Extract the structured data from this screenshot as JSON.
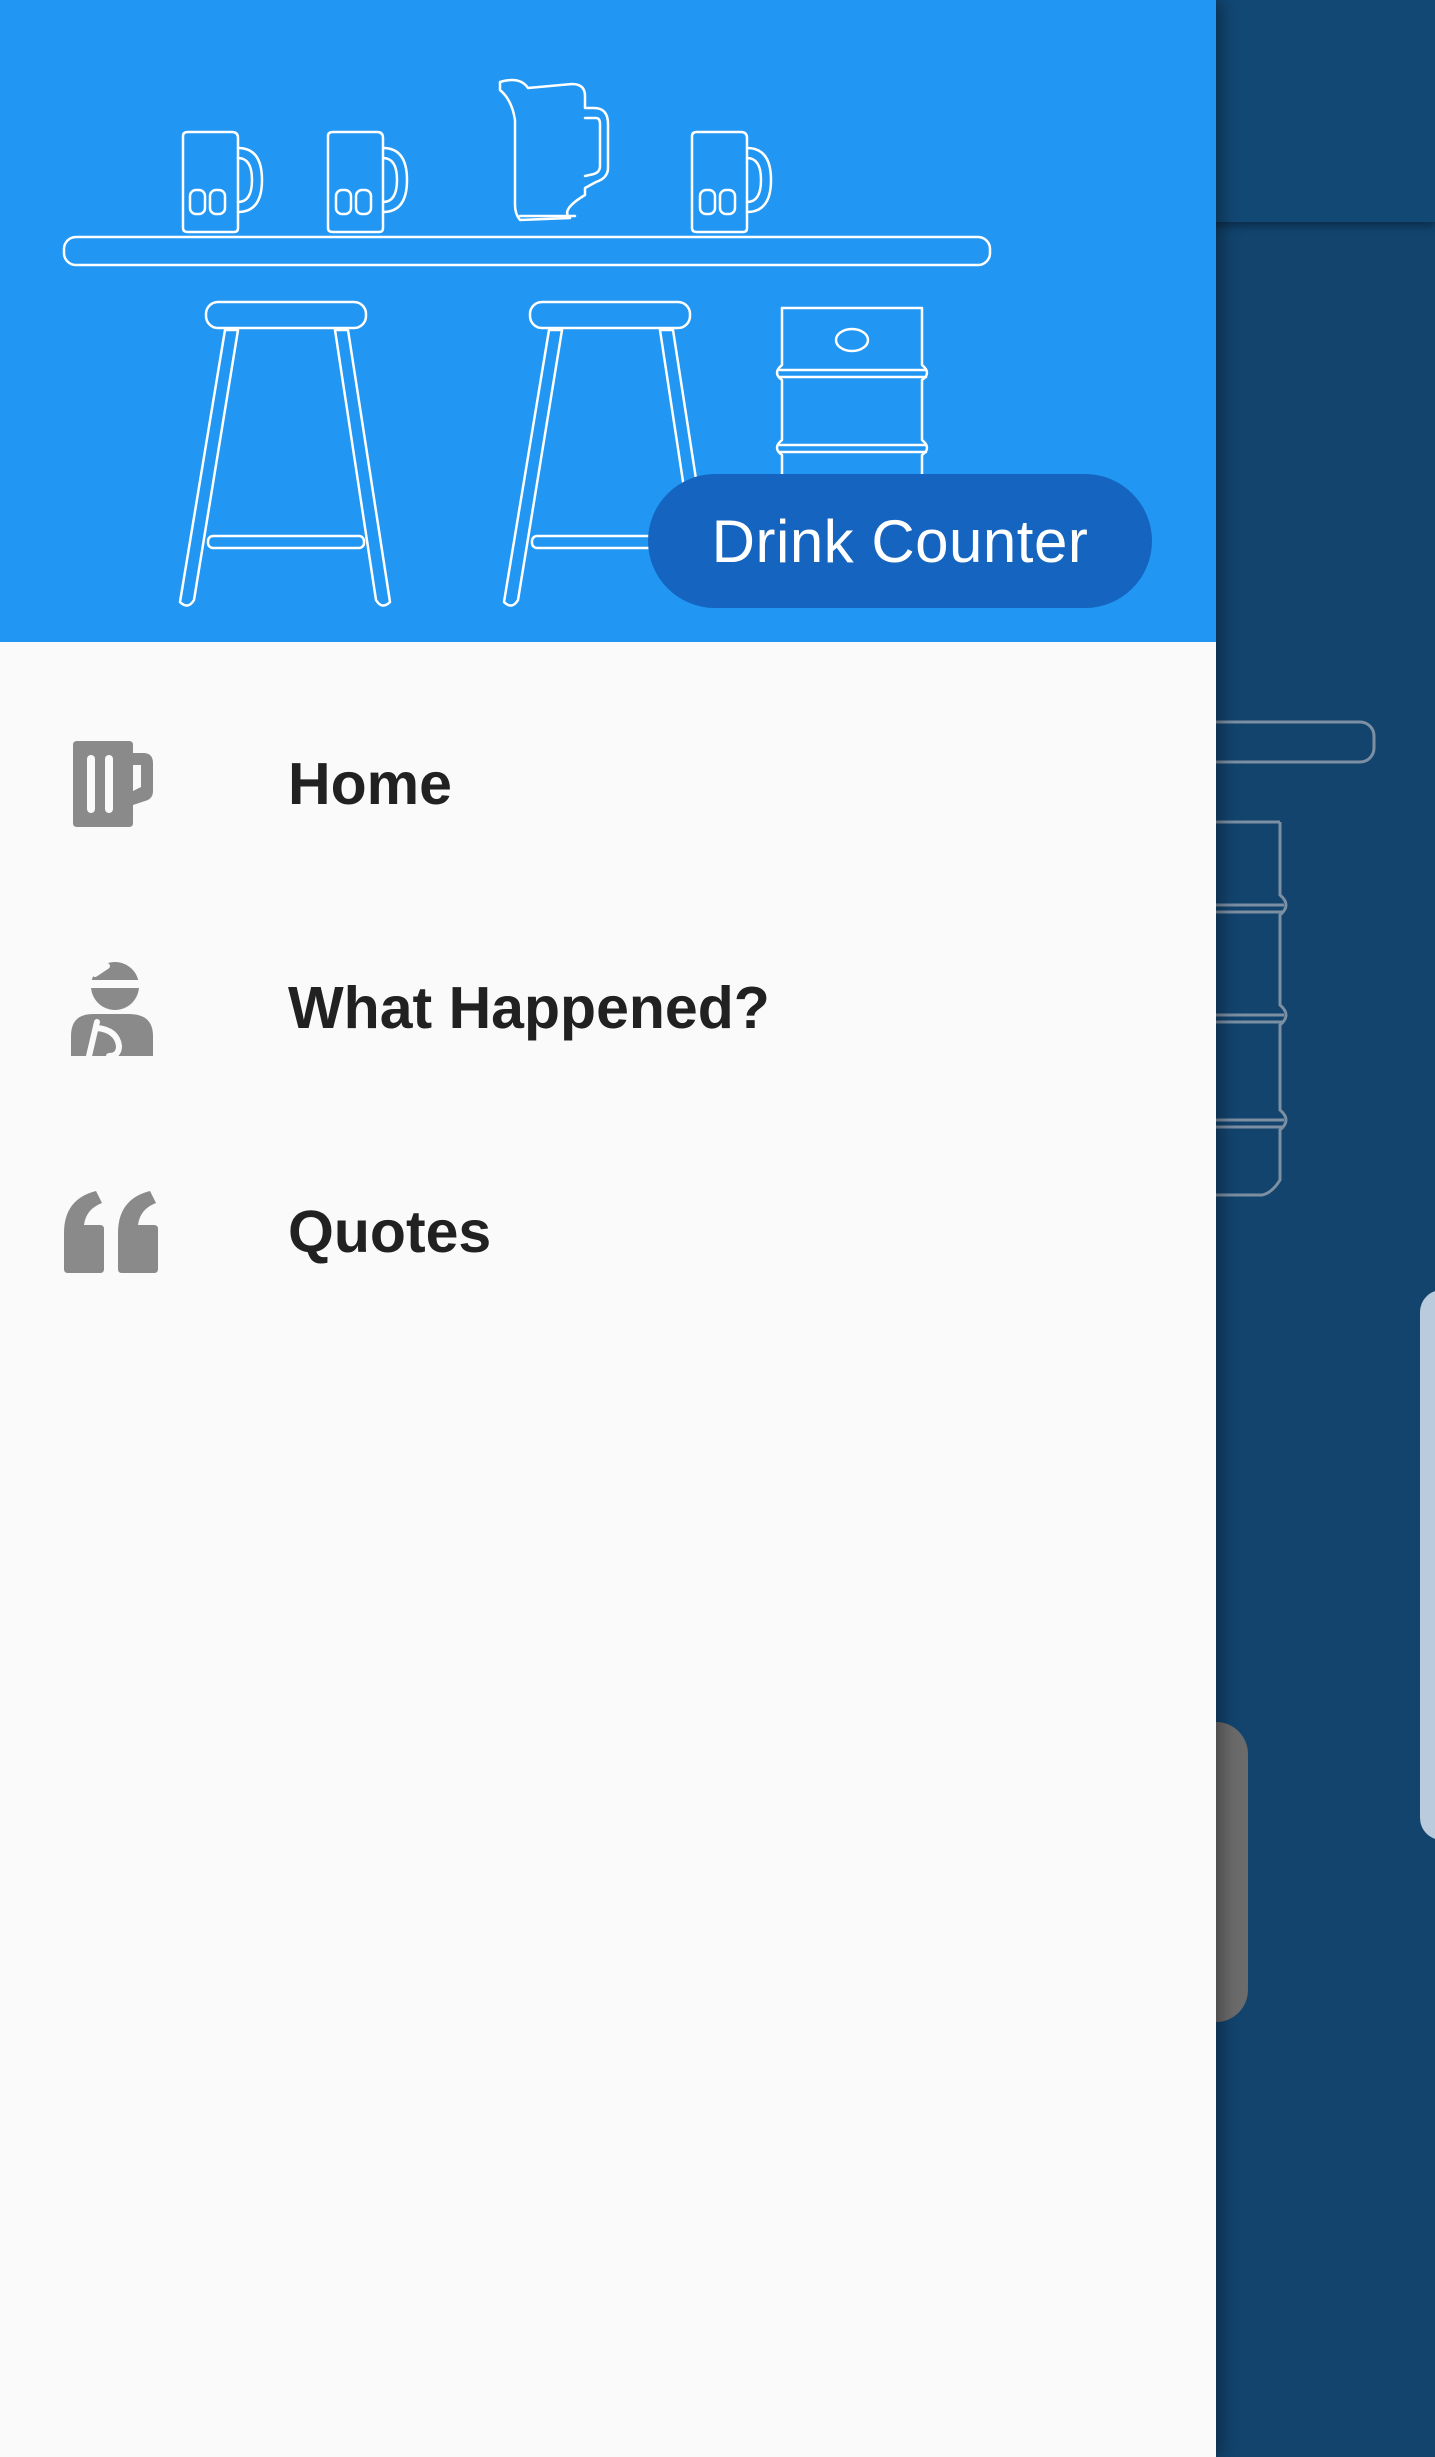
{
  "drawer": {
    "app_title": "Drink Counter",
    "items": [
      {
        "label": "Home",
        "icon": "beer-mug-icon"
      },
      {
        "label": "What Happened?",
        "icon": "injured-person-icon"
      },
      {
        "label": "Quotes",
        "icon": "quote-icon"
      }
    ]
  },
  "colors": {
    "header_background": "#2196f3",
    "title_chip": "#1565c0",
    "drawer_background": "#fafafa",
    "icon_gray": "#8a8a8a",
    "label_text": "#212121",
    "app_background": "#12446e"
  }
}
